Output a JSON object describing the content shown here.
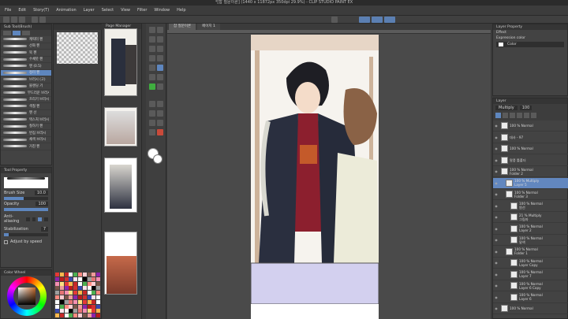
{
  "window": {
    "title": "*[잡 질문이론] (1440 x 11872px 350dpi 29.9%) - CLIP STUDIO PAINT EX"
  },
  "menu": [
    "File",
    "Edit",
    "Story(T)",
    "Animation",
    "Layer",
    "Select",
    "View",
    "Filter",
    "Window",
    "Help"
  ],
  "sub_tool": {
    "header": "Sub Tool(Brush)",
    "brushes": [
      "캐릭터 펜",
      "선화 펜",
      "묵 펜",
      "수채붓 펜",
      "펜 (0.5)",
      "정리 펜",
      "브러시 (고)",
      "블렌딩 기",
      "부드러운 브러시",
      "흐리기 브러시",
      "색칠 펜",
      "펜 선",
      "텍스처 브러시",
      "칠하기 펜",
      "번짐 브러시",
      "채색 브러시",
      "거친 펜"
    ]
  },
  "tool_property": {
    "header": "Tool Property",
    "brush_size_label": "Brush Size",
    "brush_size_value": "10.0",
    "opacity_label": "Opacity",
    "opacity_value": "100",
    "anti_aliasing_label": "Anti-aliasing",
    "stabilization_label": "Stabilization",
    "stabilization_value": "7",
    "adjust_by_speed_label": "Adjust by speed"
  },
  "color_wheel": {
    "header": "Color Wheel"
  },
  "page_manager": {
    "header": "Page Manager"
  },
  "canvas_tabs": [
    "잡 질문이론",
    "페이지 1"
  ],
  "layer_property": {
    "header": "Layer Property",
    "effect_label": "Effect",
    "expression_color_label": "Expression color",
    "expression_color_value": "Color"
  },
  "layer_panel": {
    "header": "Layer",
    "blend_mode": "Multiply",
    "opacity": "100",
    "layers": [
      {
        "line1": "100 % Normal",
        "line2": ""
      },
      {
        "line1": "대사 - 97",
        "line2": ""
      },
      {
        "line1": "100 % Normal",
        "line2": ""
      },
      {
        "line1": "말풍 틀폴더",
        "line2": ""
      },
      {
        "line1": "100 % Normal",
        "line2": "Folder 2"
      },
      {
        "line1": "100 % Multiply",
        "line2": "Layer 5"
      },
      {
        "line1": "100 % Normal",
        "line2": "Folder 3"
      },
      {
        "line1": "100 % Normal",
        "line2": "원선"
      },
      {
        "line1": "21 % Multiply",
        "line2": "그림자"
      },
      {
        "line1": "100 % Normal",
        "line2": "Layer 2"
      },
      {
        "line1": "100 % Normal",
        "line2": "밑색"
      },
      {
        "line1": "100 % Normal",
        "line2": "Folder 1"
      },
      {
        "line1": "100 % Normal",
        "line2": "Layer Copy"
      },
      {
        "line1": "100 % Normal",
        "line2": "Layer 7"
      },
      {
        "line1": "100 % Normal",
        "line2": "Layer 6 Copy"
      },
      {
        "line1": "100 % Normal",
        "line2": "Layer 6"
      },
      {
        "line1": "100 % Normal",
        "line2": ""
      }
    ]
  },
  "colors": {
    "accent": "#5e86be",
    "panel": "#434343",
    "canvas_bg": "#4a4a4a"
  }
}
